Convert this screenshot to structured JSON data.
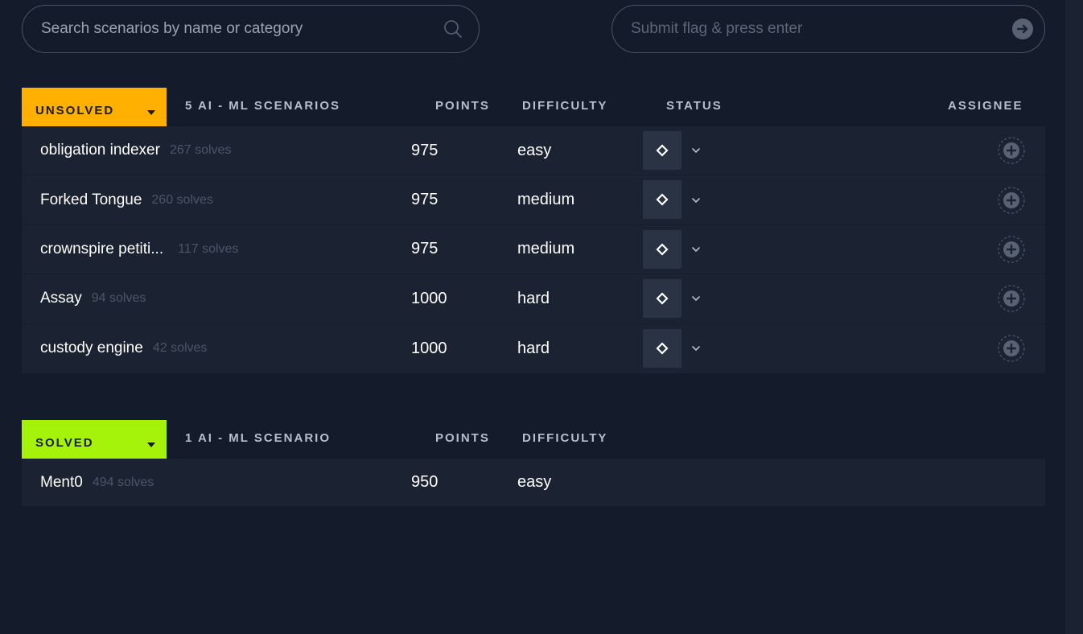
{
  "search": {
    "placeholder": "Search scenarios by name or category"
  },
  "flag": {
    "placeholder": "Submit flag & press enter"
  },
  "colors": {
    "unsolved": "#ffb000",
    "solved": "#a5f20a"
  },
  "unsolved": {
    "filter_label": "UNSOLVED",
    "count_label": "5 AI - ML SCENARIOS",
    "col_points": "POINTS",
    "col_difficulty": "DIFFICULTY",
    "col_status": "STATUS",
    "col_assignee": "ASSIGNEE",
    "rows": [
      {
        "name": "obligation indexer",
        "solves": "267 solves",
        "points": "975",
        "difficulty": "easy"
      },
      {
        "name": "Forked Tongue",
        "solves": "260 solves",
        "points": "975",
        "difficulty": "medium"
      },
      {
        "name": "crownspire petiti...",
        "solves": "117 solves",
        "points": "975",
        "difficulty": "medium"
      },
      {
        "name": "Assay",
        "solves": "94 solves",
        "points": "1000",
        "difficulty": "hard"
      },
      {
        "name": "custody engine",
        "solves": "42 solves",
        "points": "1000",
        "difficulty": "hard"
      }
    ]
  },
  "solved": {
    "filter_label": "SOLVED",
    "count_label": "1 AI - ML SCENARIO",
    "col_points": "POINTS",
    "col_difficulty": "DIFFICULTY",
    "rows": [
      {
        "name": "Ment0",
        "solves": "494 solves",
        "points": "950",
        "difficulty": "easy"
      }
    ]
  },
  "icons": {
    "search": "search-icon",
    "submit": "arrow-right-circle-icon",
    "status": "diamond-icon",
    "chevron": "chevron-down-icon",
    "assignee": "add-user-circle-icon"
  }
}
